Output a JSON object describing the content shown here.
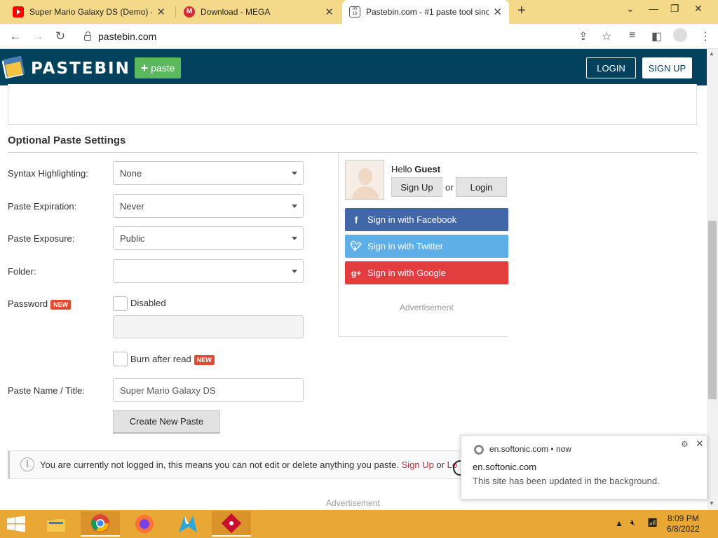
{
  "browser": {
    "tabs": [
      {
        "title": "Super Mario Galaxy DS (Demo) -",
        "favicon": "youtube-icon",
        "active": false
      },
      {
        "title": "Download - MEGA",
        "favicon": "mega-icon",
        "active": false
      },
      {
        "title": "Pastebin.com - #1 paste tool sinc",
        "favicon": "pastebin-icon",
        "active": true
      }
    ],
    "url": "pastebin.com",
    "accent": "#f5d98a"
  },
  "header": {
    "logo_text": "PASTEBIN",
    "paste_label": "paste",
    "login_label": "LOGIN",
    "signup_label": "SIGN UP",
    "bg_color": "#02425c"
  },
  "form": {
    "section_title": "Optional Paste Settings",
    "syntax_label": "Syntax Highlighting:",
    "syntax_value": "None",
    "expiration_label": "Paste Expiration:",
    "expiration_value": "Never",
    "exposure_label": "Paste Exposure:",
    "exposure_value": "Public",
    "folder_label": "Folder:",
    "folder_value": "",
    "password_label": "Password",
    "new_badge": "NEW",
    "password_checkbox_label": "Disabled",
    "burn_label": "Burn after read",
    "name_label": "Paste Name / Title:",
    "name_value": "Super Mario Galaxy DS",
    "create_label": "Create New Paste"
  },
  "sidebar": {
    "hello": "Hello",
    "guest": "Guest",
    "signup_label": "Sign Up",
    "or": "or",
    "login_label": "Login",
    "facebook_label": "Sign in with Facebook",
    "twitter_label": "Sign in with Twitter",
    "google_label": "Sign in with Google",
    "advertisement": "Advertisement"
  },
  "notice": {
    "text": "You are currently not logged in, this means you can not edit or delete anything you paste.",
    "signup_link": "Sign Up",
    "or": "or",
    "login_link_fragment": "Lo"
  },
  "footer_ad": "Advertisement",
  "toast": {
    "source": "en.softonic.com",
    "time": "now",
    "title": "en.softonic.com",
    "body": "This site has been updated in the background."
  },
  "taskbar": {
    "time": "8:09 PM",
    "date": "6/8/2022"
  }
}
